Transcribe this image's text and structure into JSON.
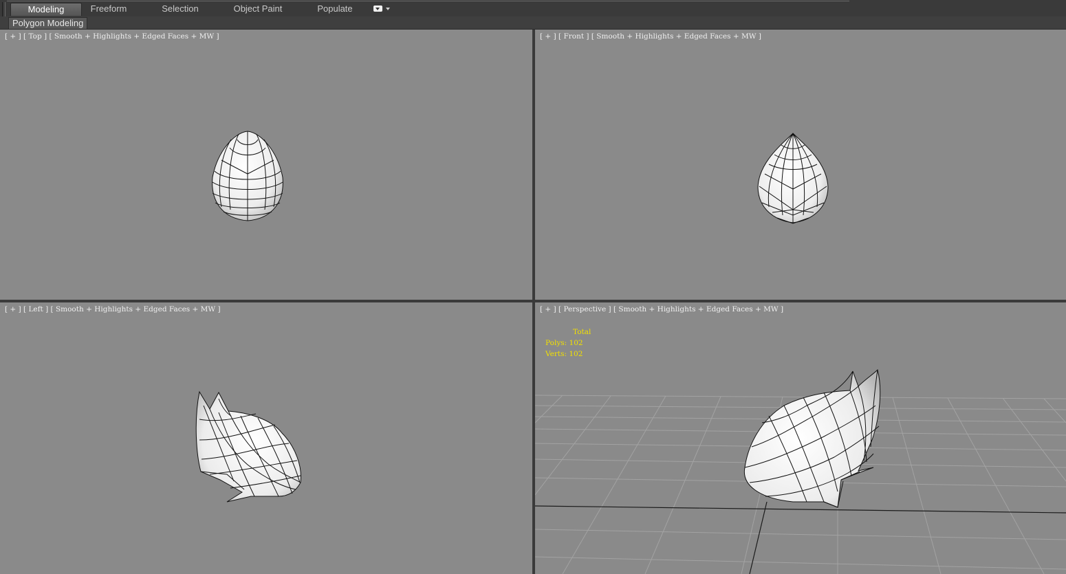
{
  "ribbon": {
    "tabs": [
      "Modeling",
      "Freeform",
      "Selection",
      "Object Paint",
      "Populate"
    ],
    "active_tab": "Modeling",
    "panel_button": "Polygon Modeling"
  },
  "viewports": {
    "top": {
      "plus": "[ + ]",
      "view": "[ Top ]",
      "shading": "[ Smooth + Highlights + Edged Faces + MW ]"
    },
    "front": {
      "plus": "[ + ]",
      "view": "[ Front ]",
      "shading": "[ Smooth + Highlights + Edged Faces + MW ]"
    },
    "left": {
      "plus": "[ + ]",
      "view": "[ Left ]",
      "shading": "[ Smooth + Highlights + Edged Faces + MW ]"
    },
    "perspective": {
      "plus": "[ + ]",
      "view": "[ Perspective ]",
      "shading": "[ Smooth + Highlights + Edged Faces + MW ]"
    }
  },
  "stats": {
    "header": "Total",
    "polys_label": "Polys:",
    "polys_value": "102",
    "verts_label": "Verts:",
    "verts_value": "102"
  },
  "colors": {
    "viewport_bg": "#8a8a8a",
    "stats_text": "#f2e000",
    "ui_bg": "#444444"
  }
}
